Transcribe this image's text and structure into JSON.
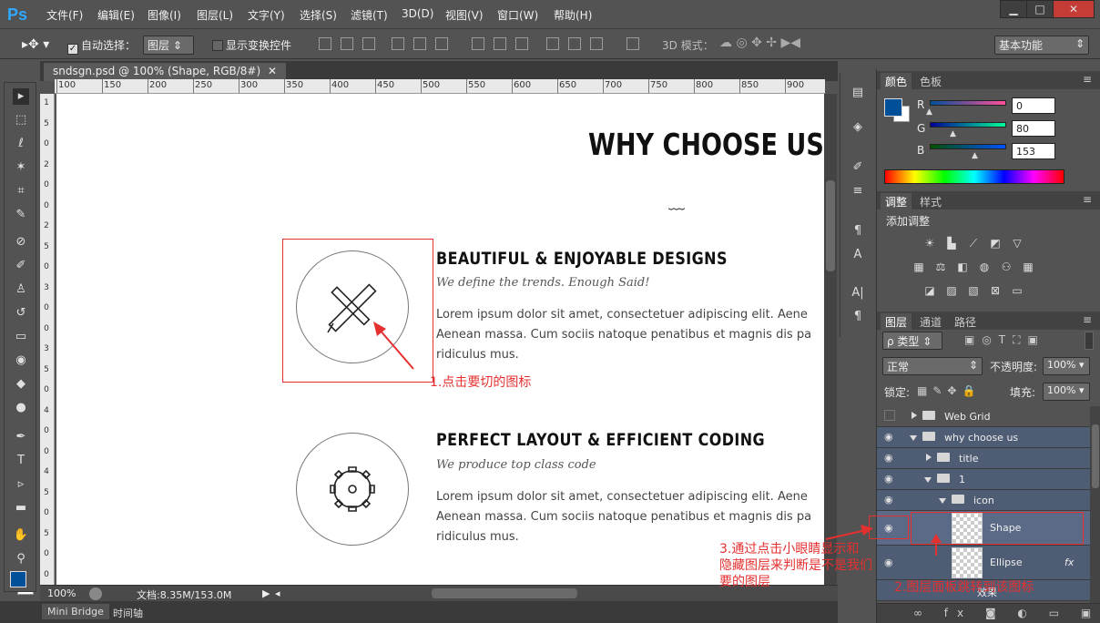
{
  "app": {
    "logo": "Ps"
  },
  "menu": [
    "文件(F)",
    "编辑(E)",
    "图像(I)",
    "图层(L)",
    "文字(Y)",
    "选择(S)",
    "滤镜(T)",
    "3D(D)",
    "视图(V)",
    "窗口(W)",
    "帮助(H)"
  ],
  "window_buttons": {
    "minimize": "▁",
    "maximize": "□",
    "close": "✕"
  },
  "options": {
    "auto_select_label": "自动选择：",
    "auto_select_value": "图层",
    "transform_controls_label": "显示变换控件",
    "mode3d_label": "3D 模式：",
    "workspace": "基本功能"
  },
  "document": {
    "tab_title": "sndsgn.psd @ 100% (Shape, RGB/8#)",
    "tab_close": "✕",
    "ruler_ticks": [
      "100",
      "150",
      "200",
      "250",
      "300",
      "350",
      "400",
      "450",
      "500",
      "550",
      "600",
      "650",
      "700",
      "750",
      "800",
      "850",
      "900"
    ],
    "vruler_labels": [
      "1",
      "5",
      "0",
      "2",
      "0",
      "0",
      "2",
      "5",
      "0",
      "3",
      "0",
      "0",
      "3",
      "5",
      "0",
      "4",
      "0",
      "0",
      "4",
      "5",
      "0",
      "5",
      "0",
      "0"
    ],
    "zoom": "100%",
    "doc_size": "文档:8.35M/153.0M"
  },
  "canvas": {
    "heading": "WHY CHOOSE US",
    "wave": "﹏",
    "features": [
      {
        "title": "BEAUTIFUL & ENJOYABLE DESIGNS",
        "subtitle": "We define the trends. Enough Said!",
        "lines": [
          "Lorem ipsum dolor sit amet, consectetuer adipiscing elit. Aene",
          "Aenean massa. Cum sociis natoque penatibus et magnis dis pa",
          "ridiculus mus."
        ]
      },
      {
        "title": "PERFECT LAYOUT & EFFICIENT CODING",
        "subtitle": "We produce top class code",
        "lines": [
          "Lorem ipsum dolor sit amet, consectetuer adipiscing elit. Aene",
          "Aenean massa. Cum sociis natoque penatibus et magnis dis pa",
          "ridiculus mus."
        ]
      }
    ]
  },
  "annotations": {
    "a1": "1.点击要切的图标",
    "a2": "2.图层面板跳转到该图标",
    "a3": [
      "3.通过点击小眼睛显示和",
      "隐藏图层来判断是不是我们",
      "要的图层"
    ]
  },
  "bottom_tabs": [
    "Mini Bridge",
    "时间轴"
  ],
  "color_panel": {
    "tabs": [
      "颜色",
      "色板"
    ],
    "channels": [
      {
        "label": "R",
        "value": "0"
      },
      {
        "label": "G",
        "value": "80"
      },
      {
        "label": "B",
        "value": "153"
      }
    ],
    "fg": "#005099",
    "r_value": 0,
    "g_value": 80,
    "b_value": 153
  },
  "adjust_panel": {
    "tabs": [
      "调整",
      "样式"
    ],
    "title": "添加调整"
  },
  "layers_panel": {
    "tabs": [
      "图层",
      "通道",
      "路径"
    ],
    "filter_label": "ρ 类型",
    "blend_mode": "正常",
    "opacity_label": "不透明度:",
    "opacity_value": "100%",
    "lock_label": "锁定:",
    "fill_label": "填充:",
    "fill_value": "100%",
    "layers": [
      {
        "name": "Web Grid",
        "visible": false,
        "indent": 0,
        "type": "group",
        "open": false
      },
      {
        "name": "why choose us",
        "visible": true,
        "indent": 0,
        "type": "group",
        "open": true
      },
      {
        "name": "title",
        "visible": true,
        "indent": 1,
        "type": "group",
        "open": false
      },
      {
        "name": "1",
        "visible": true,
        "indent": 1,
        "type": "group",
        "open": true
      },
      {
        "name": "icon",
        "visible": true,
        "indent": 2,
        "type": "group",
        "open": true
      },
      {
        "name": "Shape",
        "visible": true,
        "indent": 3,
        "type": "shape",
        "selected": true
      },
      {
        "name": "Ellipse",
        "visible": true,
        "indent": 3,
        "type": "shape",
        "fx": "fx"
      }
    ],
    "effects_label": "效果"
  }
}
